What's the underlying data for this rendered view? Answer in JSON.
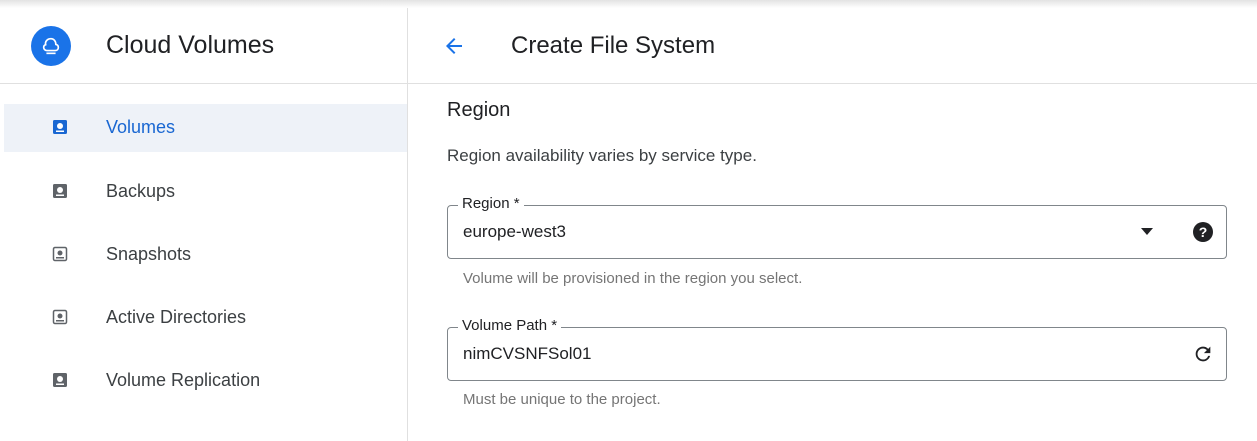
{
  "sidebar": {
    "title": "Cloud Volumes",
    "logo_icon": "cloud-volumes-logo-icon",
    "items": [
      {
        "label": "Volumes",
        "icon": "volume-icon",
        "active": true
      },
      {
        "label": "Backups",
        "icon": "backup-icon",
        "active": false
      },
      {
        "label": "Snapshots",
        "icon": "snapshot-icon",
        "active": false
      },
      {
        "label": "Active Directories",
        "icon": "active-directory-icon",
        "active": false
      },
      {
        "label": "Volume Replication",
        "icon": "replication-icon",
        "active": false
      }
    ]
  },
  "header": {
    "title": "Create File System",
    "back_icon": "arrow-back-icon"
  },
  "region_section": {
    "title": "Region",
    "description": "Region availability varies by service type.",
    "region_field": {
      "label": "Region *",
      "value": "europe-west3",
      "hint": "Volume will be provisioned in the region you select."
    },
    "volume_path_field": {
      "label": "Volume Path *",
      "value": "nimCVSNFSol01",
      "hint": "Must be unique to the project."
    }
  },
  "colors": {
    "accent": "#1a73e8",
    "active_bg": "#eef2f8",
    "active_text": "#1967d2"
  }
}
